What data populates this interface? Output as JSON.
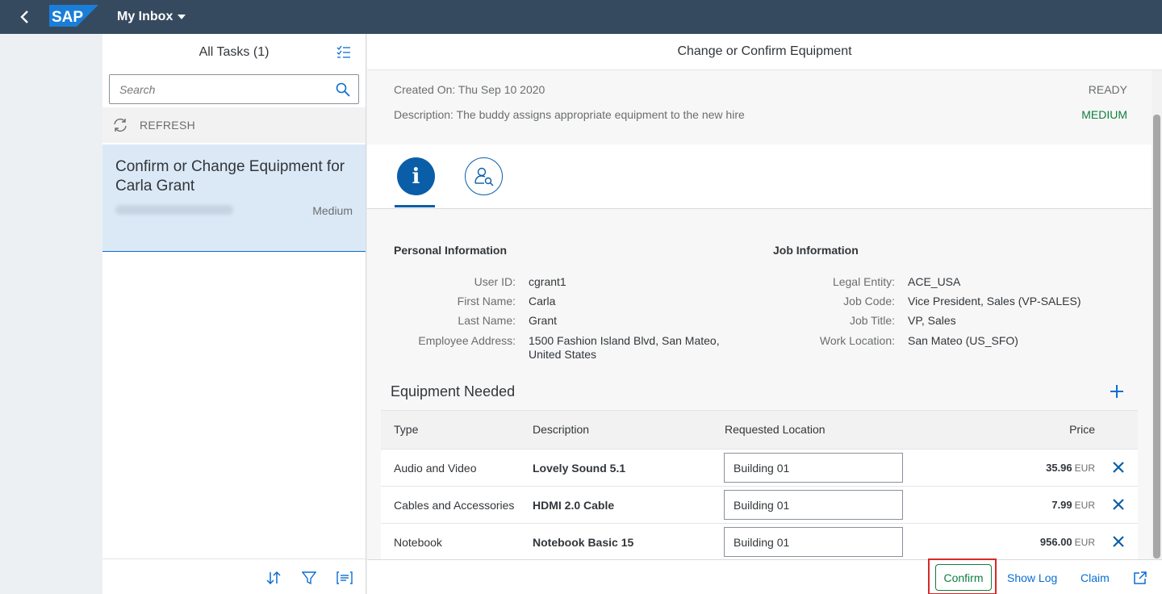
{
  "shell": {
    "title": "My Inbox",
    "logo_text": "SAP"
  },
  "master": {
    "header": "All Tasks (1)",
    "search_placeholder": "Search",
    "refresh_label": "REFRESH",
    "tasks": [
      {
        "title": "Confirm or Change Equipment for Carla Grant",
        "priority": "Medium"
      }
    ]
  },
  "detail": {
    "title": "Change or Confirm Equipment",
    "created_on": "Created On: Thu Sep 10 2020",
    "description": "Description: The buddy assigns appropriate equipment to the new hire",
    "status": "READY",
    "priority": "MEDIUM",
    "colors": {
      "priority": "#107e3e",
      "accent": "#0a5ea8",
      "shell": "#354a5f",
      "highlight": "#d62a2a"
    },
    "icons": {
      "tab_info": "info-icon",
      "tab_people": "person-search-icon"
    },
    "tab_info_glyph": "i",
    "personal": {
      "title": "Personal Information",
      "user_id_label": "User ID:",
      "user_id": "cgrant1",
      "first_name_label": "First Name:",
      "first_name": "Carla",
      "last_name_label": "Last Name:",
      "last_name": "Grant",
      "address_label": "Employee Address:",
      "address_line1": "1500 Fashion Island Blvd, San Mateo,",
      "address_line2": "United States"
    },
    "job": {
      "title": "Job Information",
      "legal_entity_label": "Legal Entity:",
      "legal_entity": "ACE_USA",
      "job_code_label": "Job Code:",
      "job_code": "Vice President, Sales (VP-SALES)",
      "job_title_label": "Job Title:",
      "job_title": "VP, Sales",
      "work_location_label": "Work Location:",
      "work_location": "San Mateo (US_SFO)"
    },
    "equipment": {
      "title": "Equipment Needed",
      "columns": {
        "type": "Type",
        "description": "Description",
        "location": "Requested Location",
        "price": "Price"
      },
      "rows": [
        {
          "type": "Audio and Video",
          "description": "Lovely Sound 5.1",
          "location": "Building 01",
          "price": "35.96",
          "currency": "EUR"
        },
        {
          "type": "Cables and Accessories",
          "description": "HDMI 2.0 Cable",
          "location": "Building 01",
          "price": "7.99",
          "currency": "EUR"
        },
        {
          "type": "Notebook",
          "description": "Notebook Basic 15",
          "location": "Building 01",
          "price": "956.00",
          "currency": "EUR"
        }
      ]
    },
    "footer": {
      "confirm": "Confirm",
      "show_log": "Show Log",
      "claim": "Claim"
    }
  }
}
